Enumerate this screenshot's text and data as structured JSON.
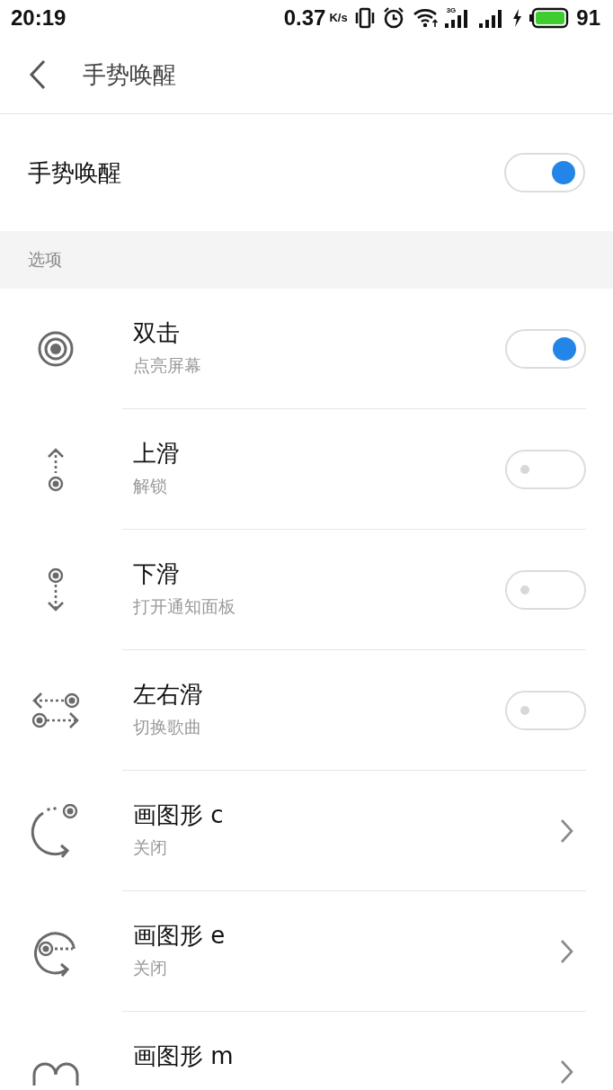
{
  "status_bar": {
    "time": "20:19",
    "speed": "0.37",
    "speed_unit": "K/s",
    "network": "3G",
    "battery": "91"
  },
  "header": {
    "title": "手势唤醒"
  },
  "master": {
    "label": "手势唤醒",
    "on": true
  },
  "section": {
    "title": "选项"
  },
  "items": [
    {
      "kind": "toggle",
      "title": "双击",
      "subtitle": "点亮屏幕",
      "on": true
    },
    {
      "kind": "toggle",
      "title": "上滑",
      "subtitle": "解锁",
      "on": false
    },
    {
      "kind": "toggle",
      "title": "下滑",
      "subtitle": "打开通知面板",
      "on": false
    },
    {
      "kind": "toggle",
      "title": "左右滑",
      "subtitle": "切换歌曲",
      "on": false
    },
    {
      "kind": "link",
      "title": "画图形 c",
      "subtitle": "关闭"
    },
    {
      "kind": "link",
      "title": "画图形 e",
      "subtitle": "关闭"
    },
    {
      "kind": "link",
      "title": "画图形 m"
    }
  ]
}
